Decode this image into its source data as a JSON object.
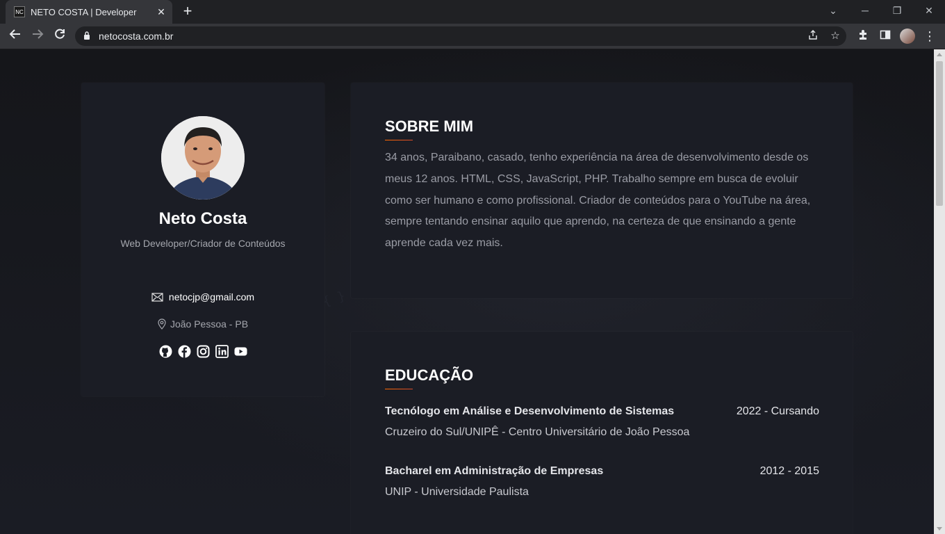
{
  "browser": {
    "tab_title": "NETO COSTA | Developer",
    "favicon_text": "NC",
    "url": "netocosta.com.br"
  },
  "profile": {
    "name": "Neto Costa",
    "role": "Web Developer/Criador de Conteúdos",
    "email": "netocjp@gmail.com",
    "location": "João Pessoa - PB",
    "social_icons": [
      "github-icon",
      "facebook-icon",
      "instagram-icon",
      "linkedin-icon",
      "youtube-icon"
    ]
  },
  "about": {
    "title": "SOBRE MIM",
    "text": "34 anos, Paraibano, casado, tenho experiência na área de desenvolvimento desde os meus 12 anos. HTML, CSS, JavaScript, PHP. Trabalho sempre em busca de evoluir como ser humano e como profissional. Criador de conteúdos para o YouTube na área, sempre tentando ensinar aquilo que aprendo, na certeza de que ensinando a gente aprende cada vez mais."
  },
  "education": {
    "title": "EDUCAÇÃO",
    "items": [
      {
        "course": "Tecnólogo em Análise e Desenvolvimento de Sistemas",
        "period": "2022 - Cursando",
        "school": "Cruzeiro do Sul/UNIPÊ - Centro Universitário de João Pessoa"
      },
      {
        "course": "Bacharel em Administração de Empresas",
        "period": "2012 - 2015",
        "school": "UNIP - Universidade Paulista"
      }
    ]
  },
  "colors": {
    "accent": "#e8561f",
    "card_bg": "#1b1d25",
    "page_bg": "#17181d"
  }
}
